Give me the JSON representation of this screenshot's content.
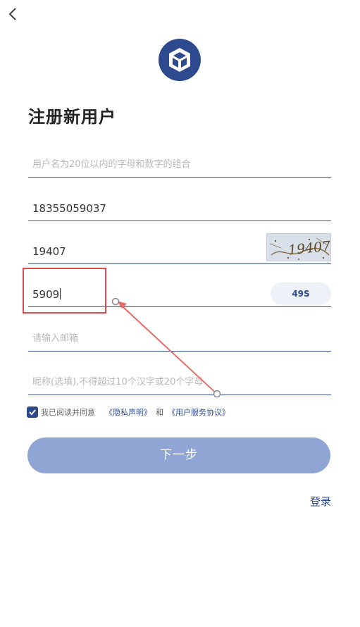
{
  "header": {
    "back_icon": "chevron-left-icon",
    "logo_icon": "cube-logo-icon",
    "brand_color": "#2e4a8f"
  },
  "page": {
    "title": "注册新用户"
  },
  "form": {
    "username": {
      "value": "",
      "placeholder": "用户名为20位以内的字母和数字的组合"
    },
    "phone": {
      "value": "18355059037"
    },
    "captcha": {
      "value": "19407",
      "image_text": "19407"
    },
    "sms_code": {
      "value": "5909",
      "countdown_label": "49S"
    },
    "email": {
      "value": "",
      "placeholder": "请输入邮箱"
    },
    "nickname": {
      "value": "",
      "placeholder": "昵称(选填),不得超过10个汉字或20个字母"
    }
  },
  "agreement": {
    "checked": true,
    "text": "我已阅读并同意",
    "privacy_link": "《隐私声明》",
    "and_text": "和",
    "terms_link": "《用户服务协议》"
  },
  "actions": {
    "next_label": "下一步",
    "login_label": "登录"
  },
  "annotation": {
    "highlight_color": "#e04a48"
  }
}
